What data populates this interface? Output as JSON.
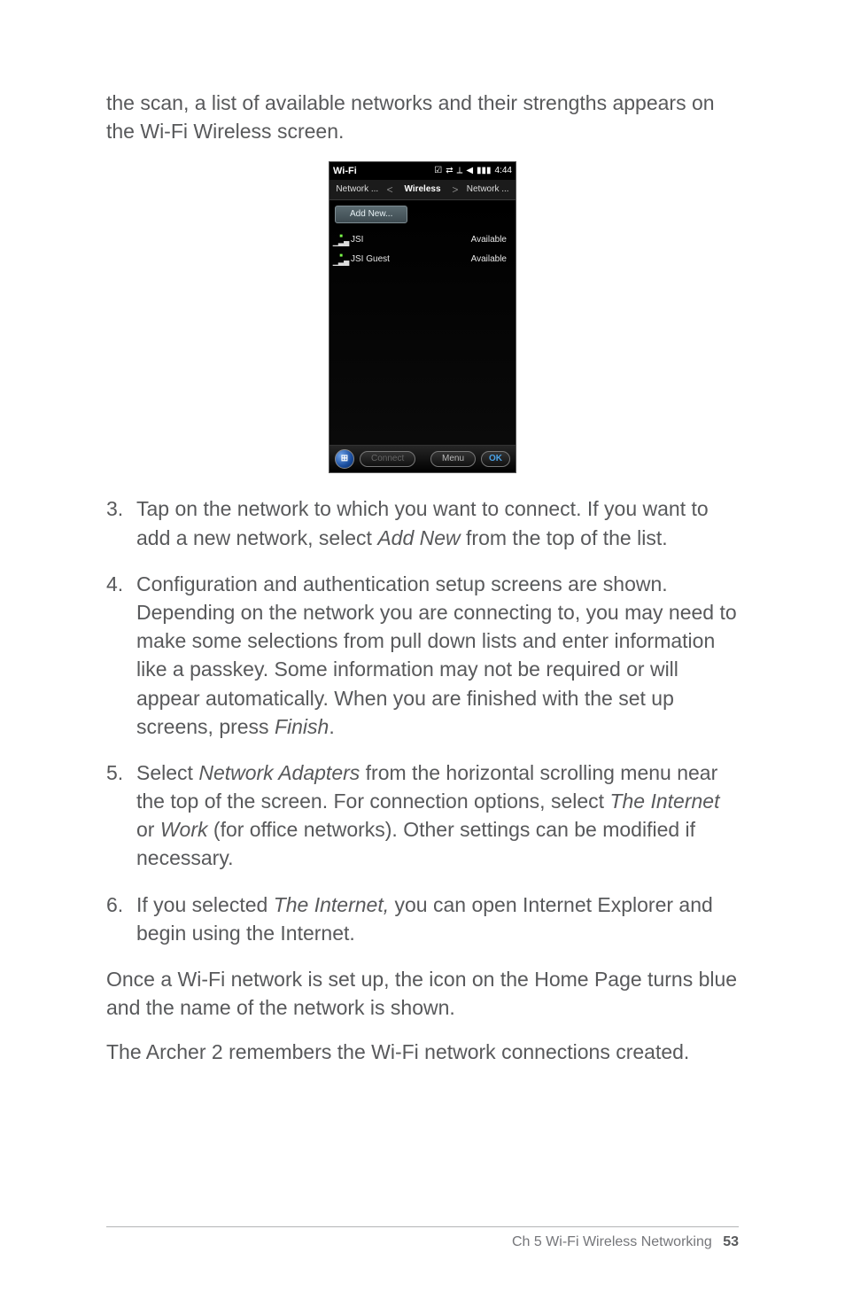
{
  "intro": "the scan, a list of available networks and their strengths appears on the Wi-Fi Wireless screen.",
  "phone": {
    "statusTitle": "Wi-Fi",
    "clock": "4:44",
    "tabs": {
      "left": "Network ...",
      "center": "Wireless",
      "right": "Network ..."
    },
    "addNew": "Add New...",
    "networks": [
      {
        "name": "JSI",
        "status": "Available"
      },
      {
        "name": "JSI Guest",
        "status": "Available"
      }
    ],
    "softkeys": {
      "connect": "Connect",
      "menu": "Menu",
      "ok": "OK"
    }
  },
  "steps": [
    {
      "num": "3.",
      "parts": [
        {
          "t": "Tap on the network to which you want to connect. If you want to add a new network, select "
        },
        {
          "t": "Add New",
          "i": true
        },
        {
          "t": " from the top of the list."
        }
      ]
    },
    {
      "num": "4.",
      "parts": [
        {
          "t": "Configuration and authentication setup screens are shown. Depending on the network you are connecting to, you may need to make some selections from pull down lists and enter information like a passkey. Some information may not be required or will appear automatically. When you are finished with the set up screens, press "
        },
        {
          "t": "Finish",
          "i": true
        },
        {
          "t": "."
        }
      ]
    },
    {
      "num": "5.",
      "parts": [
        {
          "t": "Select "
        },
        {
          "t": "Network Adapters",
          "i": true
        },
        {
          "t": " from the horizontal scrolling menu near the top of the screen. For connection options, select "
        },
        {
          "t": "The Internet",
          "i": true
        },
        {
          "t": " or "
        },
        {
          "t": "Work",
          "i": true
        },
        {
          "t": " (for office networks). Other settings can be modified if necessary."
        }
      ]
    },
    {
      "num": "6.",
      "parts": [
        {
          "t": "If you selected "
        },
        {
          "t": "The Internet,",
          "i": true
        },
        {
          "t": " you can open Internet Explorer and begin using the Internet."
        }
      ]
    }
  ],
  "para1": "Once a Wi-Fi network is set up, the icon on the Home Page turns blue and the name of the network is shown.",
  "para2": "The Archer 2 remembers the Wi-Fi network connections created.",
  "footer": {
    "chapter": "Ch 5   Wi-Fi Wireless Networking",
    "page": "53"
  }
}
